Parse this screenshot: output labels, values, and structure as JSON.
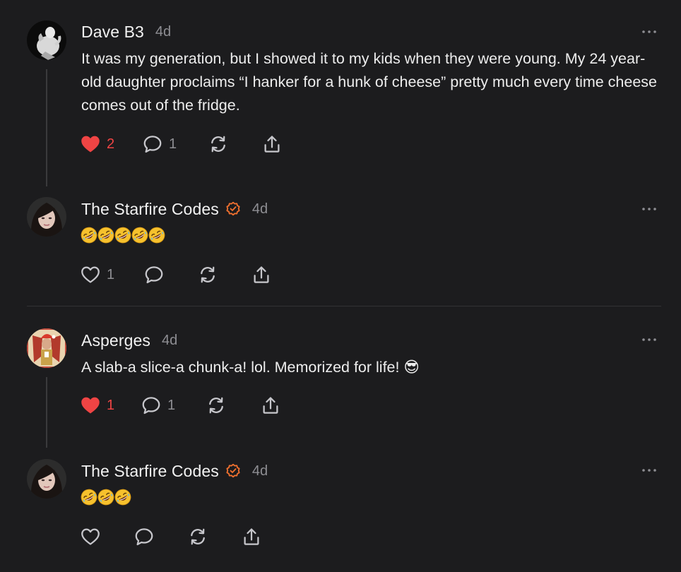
{
  "colors": {
    "background": "#1c1c1e",
    "liked_heart": "#ef4444",
    "verified_badge": "#f2712f",
    "muted_text": "#8e8e93",
    "icon_stroke": "#c7c7cc"
  },
  "comments": [
    {
      "author": "Dave B3",
      "verified": false,
      "time": "4d",
      "text": "It was my generation, but I showed it to my kids when they were young. My 24 year-old daughter proclaims “I hanker for a hunk of cheese” pretty much every time cheese comes out of the fridge.",
      "likes": "2",
      "liked": true,
      "replies": "1"
    },
    {
      "author": "The Starfire Codes",
      "verified": true,
      "time": "4d",
      "emoji_count": 5,
      "emoji": "rolling-on-floor-laughing",
      "likes": "1",
      "liked": false,
      "replies": ""
    },
    {
      "author": "Asperges",
      "verified": false,
      "time": "4d",
      "text": "A slab-a slice-a chunk-a! lol. Memorized for life! 😎",
      "likes": "1",
      "liked": true,
      "replies": "1"
    },
    {
      "author": "The Starfire Codes",
      "verified": true,
      "time": "4d",
      "emoji_count": 3,
      "emoji": "rolling-on-floor-laughing",
      "likes": "",
      "liked": false,
      "replies": ""
    }
  ],
  "icons": {
    "like": "heart-icon",
    "reply": "comment-bubble-icon",
    "restack": "restack-icon",
    "share": "share-icon",
    "more": "more-options-icon",
    "verified": "verified-badge-icon"
  }
}
